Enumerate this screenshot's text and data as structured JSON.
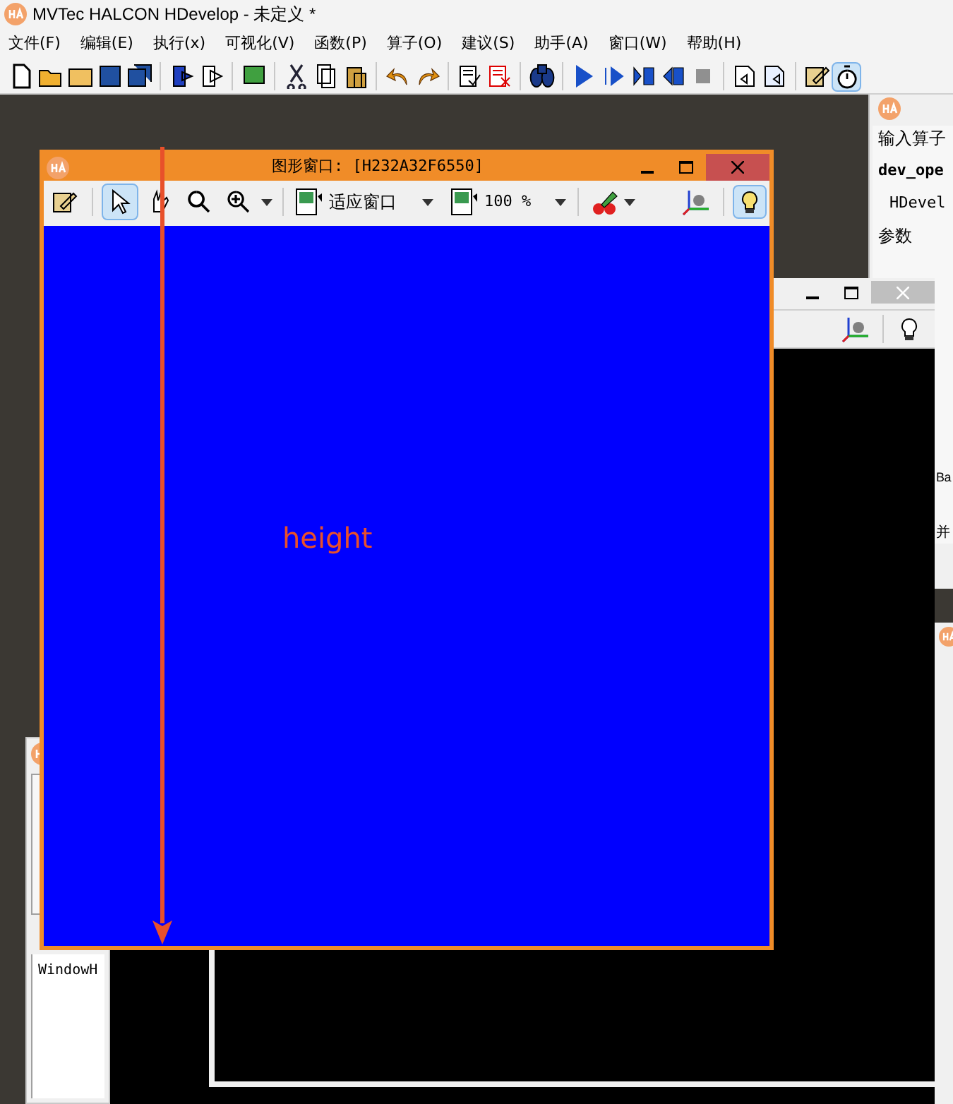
{
  "app": {
    "title": "MVTec HALCON HDevelop - 未定义 *"
  },
  "menu": [
    "文件(F)",
    "编辑(E)",
    "执行(x)",
    "可视化(V)",
    "函数(P)",
    "算子(O)",
    "建议(S)",
    "助手(A)",
    "窗口(W)",
    "帮助(H)"
  ],
  "toolbar": {
    "groups": [
      {
        "buttons": [
          {
            "kind": "new",
            "selected": false
          },
          {
            "kind": "open",
            "selected": false
          },
          {
            "kind": "open-example",
            "selected": false
          },
          {
            "kind": "save",
            "selected": false
          },
          {
            "kind": "save-all",
            "selected": false
          }
        ]
      },
      {
        "buttons": [
          {
            "kind": "export",
            "selected": false
          },
          {
            "kind": "run-step",
            "selected": false
          }
        ]
      },
      {
        "buttons": [
          {
            "kind": "image",
            "selected": false
          }
        ]
      },
      {
        "buttons": [
          {
            "kind": "cut",
            "selected": false
          },
          {
            "kind": "copy",
            "selected": false
          },
          {
            "kind": "paste",
            "selected": false
          }
        ]
      },
      {
        "buttons": [
          {
            "kind": "undo",
            "selected": false
          },
          {
            "kind": "redo",
            "selected": false
          }
        ]
      },
      {
        "buttons": [
          {
            "kind": "activate",
            "selected": false
          },
          {
            "kind": "deactivate",
            "selected": false
          }
        ]
      },
      {
        "buttons": [
          {
            "kind": "find",
            "selected": false
          }
        ]
      },
      {
        "buttons": [
          {
            "kind": "run",
            "selected": false
          },
          {
            "kind": "step-over",
            "selected": false
          },
          {
            "kind": "step-into",
            "selected": false
          },
          {
            "kind": "step-out",
            "selected": false
          },
          {
            "kind": "stop",
            "selected": false
          }
        ]
      },
      {
        "buttons": [
          {
            "kind": "reset",
            "selected": false
          },
          {
            "kind": "reset-procedure",
            "selected": false
          }
        ]
      },
      {
        "buttons": [
          {
            "kind": "edit",
            "selected": false
          },
          {
            "kind": "stopwatch",
            "selected": true
          }
        ]
      }
    ]
  },
  "graphics_window": {
    "title": "图形窗口: [H232A32F6550]",
    "tools": [
      {
        "kind": "edit",
        "selected": false
      },
      {
        "kind": "pointer",
        "selected": true
      },
      {
        "kind": "pan",
        "selected": false
      },
      {
        "kind": "magnifier",
        "selected": false
      },
      {
        "kind": "zoom-in",
        "selected": false
      }
    ],
    "zoom_mode": "适应窗口",
    "zoom_percent": "100 %",
    "highlight": {
      "selected": true
    }
  },
  "annotation": {
    "label": "height"
  },
  "back_window": {
    "highlight": {
      "selected": false
    }
  },
  "operator_panel": {
    "lines": [
      {
        "kind": "label",
        "text": "输入算子"
      },
      {
        "kind": "code",
        "text": "dev_ope"
      },
      {
        "kind": "code-sub",
        "text": "HDevel"
      },
      {
        "kind": "section",
        "text": "参数"
      },
      {
        "kind": "code",
        "text": "Ba"
      },
      {
        "kind": "label",
        "text": "并"
      }
    ]
  },
  "variables_panel": {
    "items": [
      "WindowH"
    ]
  }
}
